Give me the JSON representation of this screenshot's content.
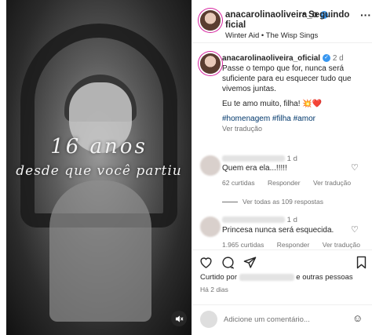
{
  "media": {
    "overlay_title": "16 anos",
    "overlay_subtitle": "desde que você partiu",
    "mute_icon": "speaker-muted-icon"
  },
  "header": {
    "username_line1": "anacarolinaoliveira_o",
    "username_line2": "ficial",
    "separator": "•",
    "follow_label": "Seguindo",
    "music": "Winter Aid • The Wisp Sings",
    "more": "···"
  },
  "caption": {
    "username": "anacarolinaoliveira_oficial",
    "time": "2 d",
    "paragraph1": "Passe o tempo que for, nunca será suficiente para eu esquecer tudo que vivemos juntas.",
    "paragraph2": "Eu te amo muito, filha! 💥❤️",
    "hashtags": "#homenagem #filha #amor",
    "translate": "Ver tradução"
  },
  "comments": [
    {
      "time": "1 d",
      "text": "Quem era ela...!!!!!",
      "likes": "62 curtidas",
      "reply": "Responder",
      "translate": "Ver tradução",
      "more_replies": "Ver todas as 109 respostas"
    },
    {
      "time": "1 d",
      "text": "Princesa nunca será esquecida.",
      "likes": "1.965 curtidas",
      "reply": "Responder",
      "translate": "Ver tradução"
    }
  ],
  "liked_by": {
    "prefix": "Curtido por",
    "suffix": "e outras pessoas"
  },
  "date": "Há 2 dias",
  "add_comment": {
    "placeholder": "Adicione um comentário..."
  },
  "colors": {
    "verified": "#3897f0",
    "story_ring": "#d6249f",
    "muted_text": "#737373",
    "hashtag": "#00376b"
  }
}
